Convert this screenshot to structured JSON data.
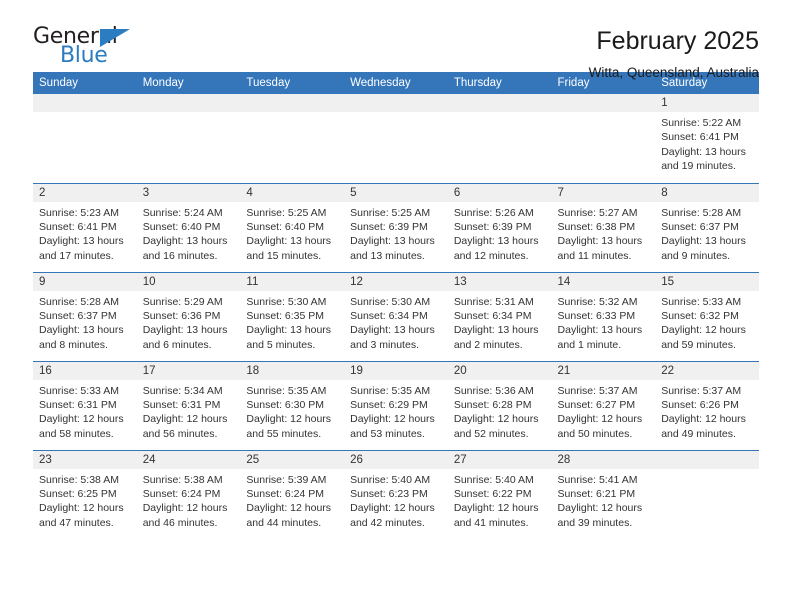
{
  "brand": {
    "name_top": "General",
    "name_bottom": "Blue",
    "accent_color": "#2b7cc0"
  },
  "header": {
    "title": "February 2025",
    "location": "Witta, Queensland, Australia"
  },
  "theme": {
    "header_bar_color": "#3575ba",
    "date_band_color": "#f0f0f0",
    "text_color": "#333333"
  },
  "weekday_headers": [
    "Sunday",
    "Monday",
    "Tuesday",
    "Wednesday",
    "Thursday",
    "Friday",
    "Saturday"
  ],
  "weeks": [
    [
      {
        "day": "",
        "lines": []
      },
      {
        "day": "",
        "lines": []
      },
      {
        "day": "",
        "lines": []
      },
      {
        "day": "",
        "lines": []
      },
      {
        "day": "",
        "lines": []
      },
      {
        "day": "",
        "lines": []
      },
      {
        "day": "1",
        "lines": [
          "Sunrise: 5:22 AM",
          "Sunset: 6:41 PM",
          "Daylight: 13 hours",
          "and 19 minutes."
        ]
      }
    ],
    [
      {
        "day": "2",
        "lines": [
          "Sunrise: 5:23 AM",
          "Sunset: 6:41 PM",
          "Daylight: 13 hours",
          "and 17 minutes."
        ]
      },
      {
        "day": "3",
        "lines": [
          "Sunrise: 5:24 AM",
          "Sunset: 6:40 PM",
          "Daylight: 13 hours",
          "and 16 minutes."
        ]
      },
      {
        "day": "4",
        "lines": [
          "Sunrise: 5:25 AM",
          "Sunset: 6:40 PM",
          "Daylight: 13 hours",
          "and 15 minutes."
        ]
      },
      {
        "day": "5",
        "lines": [
          "Sunrise: 5:25 AM",
          "Sunset: 6:39 PM",
          "Daylight: 13 hours",
          "and 13 minutes."
        ]
      },
      {
        "day": "6",
        "lines": [
          "Sunrise: 5:26 AM",
          "Sunset: 6:39 PM",
          "Daylight: 13 hours",
          "and 12 minutes."
        ]
      },
      {
        "day": "7",
        "lines": [
          "Sunrise: 5:27 AM",
          "Sunset: 6:38 PM",
          "Daylight: 13 hours",
          "and 11 minutes."
        ]
      },
      {
        "day": "8",
        "lines": [
          "Sunrise: 5:28 AM",
          "Sunset: 6:37 PM",
          "Daylight: 13 hours",
          "and 9 minutes."
        ]
      }
    ],
    [
      {
        "day": "9",
        "lines": [
          "Sunrise: 5:28 AM",
          "Sunset: 6:37 PM",
          "Daylight: 13 hours",
          "and 8 minutes."
        ]
      },
      {
        "day": "10",
        "lines": [
          "Sunrise: 5:29 AM",
          "Sunset: 6:36 PM",
          "Daylight: 13 hours",
          "and 6 minutes."
        ]
      },
      {
        "day": "11",
        "lines": [
          "Sunrise: 5:30 AM",
          "Sunset: 6:35 PM",
          "Daylight: 13 hours",
          "and 5 minutes."
        ]
      },
      {
        "day": "12",
        "lines": [
          "Sunrise: 5:30 AM",
          "Sunset: 6:34 PM",
          "Daylight: 13 hours",
          "and 3 minutes."
        ]
      },
      {
        "day": "13",
        "lines": [
          "Sunrise: 5:31 AM",
          "Sunset: 6:34 PM",
          "Daylight: 13 hours",
          "and 2 minutes."
        ]
      },
      {
        "day": "14",
        "lines": [
          "Sunrise: 5:32 AM",
          "Sunset: 6:33 PM",
          "Daylight: 13 hours",
          "and 1 minute."
        ]
      },
      {
        "day": "15",
        "lines": [
          "Sunrise: 5:33 AM",
          "Sunset: 6:32 PM",
          "Daylight: 12 hours",
          "and 59 minutes."
        ]
      }
    ],
    [
      {
        "day": "16",
        "lines": [
          "Sunrise: 5:33 AM",
          "Sunset: 6:31 PM",
          "Daylight: 12 hours",
          "and 58 minutes."
        ]
      },
      {
        "day": "17",
        "lines": [
          "Sunrise: 5:34 AM",
          "Sunset: 6:31 PM",
          "Daylight: 12 hours",
          "and 56 minutes."
        ]
      },
      {
        "day": "18",
        "lines": [
          "Sunrise: 5:35 AM",
          "Sunset: 6:30 PM",
          "Daylight: 12 hours",
          "and 55 minutes."
        ]
      },
      {
        "day": "19",
        "lines": [
          "Sunrise: 5:35 AM",
          "Sunset: 6:29 PM",
          "Daylight: 12 hours",
          "and 53 minutes."
        ]
      },
      {
        "day": "20",
        "lines": [
          "Sunrise: 5:36 AM",
          "Sunset: 6:28 PM",
          "Daylight: 12 hours",
          "and 52 minutes."
        ]
      },
      {
        "day": "21",
        "lines": [
          "Sunrise: 5:37 AM",
          "Sunset: 6:27 PM",
          "Daylight: 12 hours",
          "and 50 minutes."
        ]
      },
      {
        "day": "22",
        "lines": [
          "Sunrise: 5:37 AM",
          "Sunset: 6:26 PM",
          "Daylight: 12 hours",
          "and 49 minutes."
        ]
      }
    ],
    [
      {
        "day": "23",
        "lines": [
          "Sunrise: 5:38 AM",
          "Sunset: 6:25 PM",
          "Daylight: 12 hours",
          "and 47 minutes."
        ]
      },
      {
        "day": "24",
        "lines": [
          "Sunrise: 5:38 AM",
          "Sunset: 6:24 PM",
          "Daylight: 12 hours",
          "and 46 minutes."
        ]
      },
      {
        "day": "25",
        "lines": [
          "Sunrise: 5:39 AM",
          "Sunset: 6:24 PM",
          "Daylight: 12 hours",
          "and 44 minutes."
        ]
      },
      {
        "day": "26",
        "lines": [
          "Sunrise: 5:40 AM",
          "Sunset: 6:23 PM",
          "Daylight: 12 hours",
          "and 42 minutes."
        ]
      },
      {
        "day": "27",
        "lines": [
          "Sunrise: 5:40 AM",
          "Sunset: 6:22 PM",
          "Daylight: 12 hours",
          "and 41 minutes."
        ]
      },
      {
        "day": "28",
        "lines": [
          "Sunrise: 5:41 AM",
          "Sunset: 6:21 PM",
          "Daylight: 12 hours",
          "and 39 minutes."
        ]
      },
      {
        "day": "",
        "lines": []
      }
    ]
  ]
}
